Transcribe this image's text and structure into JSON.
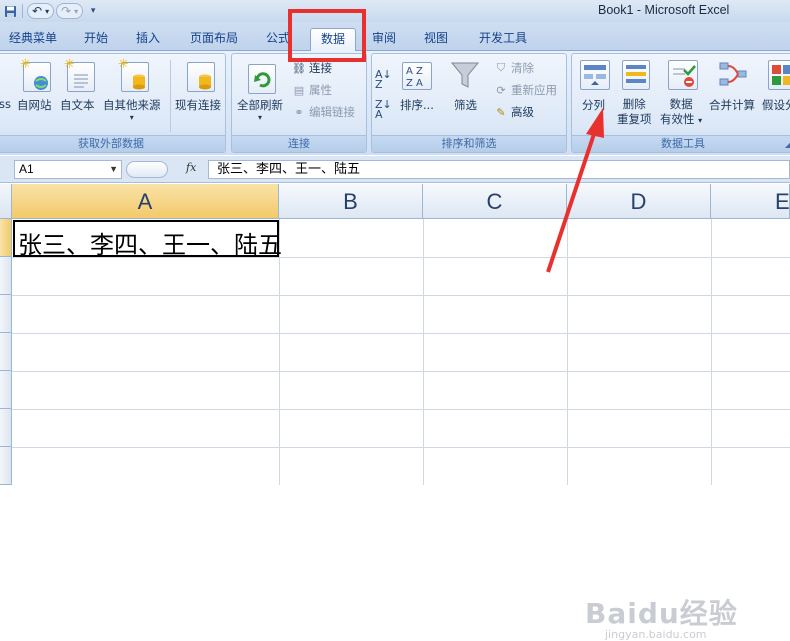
{
  "window": {
    "title": "Book1 - Microsoft Excel"
  },
  "tabs": [
    {
      "label": "经典菜单"
    },
    {
      "label": "开始"
    },
    {
      "label": "插入"
    },
    {
      "label": "页面布局"
    },
    {
      "label": "公式"
    },
    {
      "label": "数据",
      "active": true
    },
    {
      "label": "审阅"
    },
    {
      "label": "视图"
    },
    {
      "label": "开发工具"
    }
  ],
  "ribbon": {
    "get_external_data": {
      "label": "获取外部数据",
      "access_fragment": "ss",
      "from_web": "自网站",
      "from_text": "自文本",
      "from_other": "自其他来源",
      "existing": "现有连接"
    },
    "connections": {
      "label": "连接",
      "refresh_all": "全部刷新",
      "connections": "连接",
      "properties": "属性",
      "edit_links": "编辑链接"
    },
    "sort_filter": {
      "label": "排序和筛选",
      "sort": "排序...",
      "filter": "筛选",
      "clear": "清除",
      "reapply": "重新应用",
      "advanced": "高级"
    },
    "data_tools": {
      "label": "数据工具",
      "text_to_columns": "分列",
      "remove_dup_1": "删除",
      "remove_dup_2": "重复项",
      "validation_1": "数据",
      "validation_2": "有效性",
      "consolidate": "合并计算",
      "what_if": "假设分"
    }
  },
  "formula_bar": {
    "name_box": "A1",
    "fx": "fx",
    "formula": "张三、李四、王一、陆五"
  },
  "sheet": {
    "columns": [
      "A",
      "B",
      "C",
      "D",
      "E"
    ],
    "cells": {
      "A1": "张三、李四、王一、陆五"
    }
  },
  "watermark": {
    "line1": "Baidu经验",
    "line2": "jingyan.baidu.com"
  },
  "colors": {
    "highlight_box": "#e8312f",
    "arrow": "#e8312f",
    "selected_header": "#f3c96a"
  },
  "annotation": {
    "target": "text-to-columns-button"
  }
}
